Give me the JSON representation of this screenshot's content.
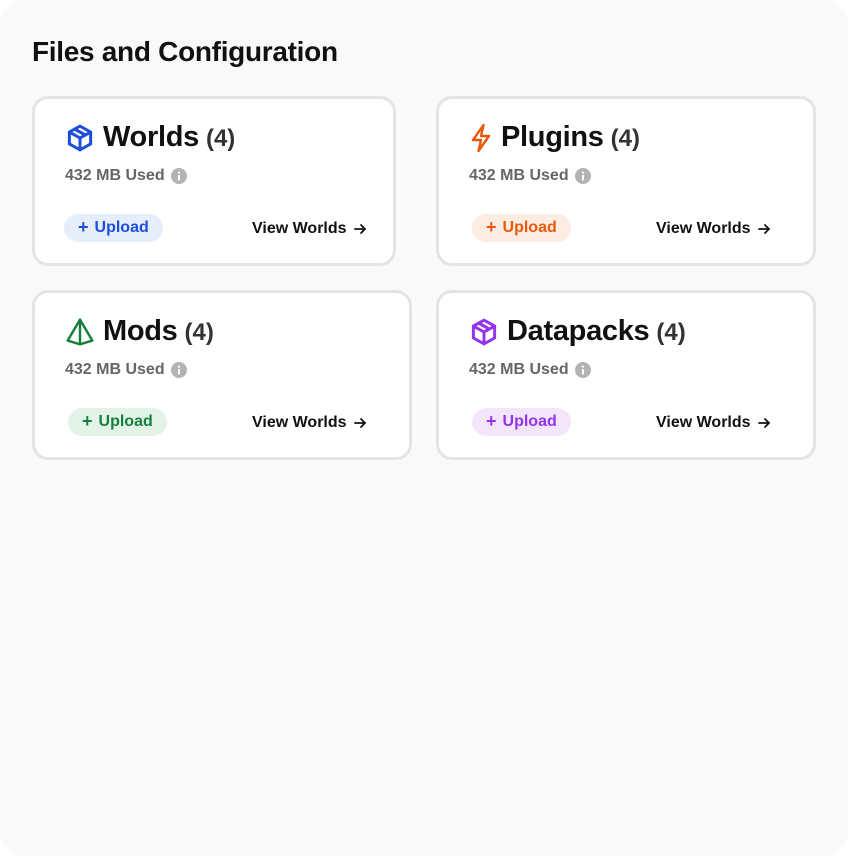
{
  "page": {
    "title": "Files and Configuration"
  },
  "cards": [
    {
      "key": "worlds",
      "icon": "cube-icon",
      "title": "Worlds",
      "count": "(4)",
      "usage": "432 MB Used",
      "upload_label": "Upload",
      "view_label": "View Worlds",
      "accent": "#1d4ed8",
      "upload_bg": "#e6edfb"
    },
    {
      "key": "plugins",
      "icon": "lightning-icon",
      "title": "Plugins",
      "count": "(4)",
      "usage": "432 MB Used",
      "upload_label": "Upload",
      "view_label": "View Worlds",
      "accent": "#ea580c",
      "upload_bg": "#fdece2"
    },
    {
      "key": "mods",
      "icon": "pyramid-icon",
      "title": "Mods",
      "count": "(4)",
      "usage": "432 MB Used",
      "upload_label": "Upload",
      "view_label": "View Worlds",
      "accent": "#15803d",
      "upload_bg": "#e3f3e7"
    },
    {
      "key": "datapacks",
      "icon": "package-icon",
      "title": "Datapacks",
      "count": "(4)",
      "usage": "432 MB Used",
      "upload_label": "Upload",
      "view_label": "View Worlds",
      "accent": "#9333ea",
      "upload_bg": "#f3e6fb"
    }
  ],
  "colors": {
    "panel_bg": "#f9f9f9",
    "card_border": "#e4e4e4",
    "info_icon": "#b3b3b3"
  }
}
